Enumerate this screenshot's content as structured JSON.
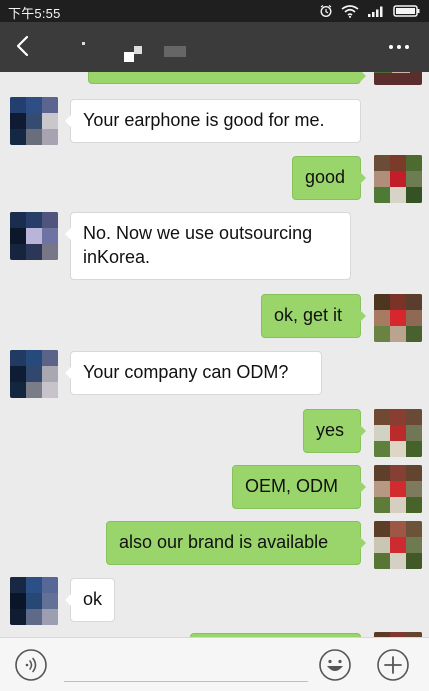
{
  "status_bar": {
    "time": "下午5:55",
    "icons": [
      "alarm-icon",
      "wifi-icon",
      "signal-icon",
      "battery-icon"
    ]
  },
  "header": {
    "contact_name": "",
    "back_icon": "chevron-left-icon",
    "more_icon": "more-dots-icon"
  },
  "messages": [
    {
      "side": "out",
      "text": ""
    },
    {
      "side": "in",
      "text": "Your earphone is good for me."
    },
    {
      "side": "out",
      "text": "good"
    },
    {
      "side": "in",
      "text": "No. Now we use outsourcing\ninKorea."
    },
    {
      "side": "out",
      "text": "ok, get it"
    },
    {
      "side": "in",
      "text": "Your company can ODM?"
    },
    {
      "side": "out",
      "text": "yes"
    },
    {
      "side": "out",
      "text": "OEM, ODM"
    },
    {
      "side": "out",
      "text": "also our brand is available"
    },
    {
      "side": "in",
      "text": "ok"
    },
    {
      "side": "out",
      "text": ""
    }
  ],
  "input_bar": {
    "placeholder": "",
    "voice_icon": "voice-icon",
    "emoji_icon": "emoji-icon",
    "plus_icon": "plus-icon"
  },
  "colors": {
    "header_bg": "#3b3b3b",
    "status_bg": "#1f1f1f",
    "chat_bg": "#ebebeb",
    "outgoing_bubble": "#9ad56c",
    "incoming_bubble": "#ffffff"
  }
}
